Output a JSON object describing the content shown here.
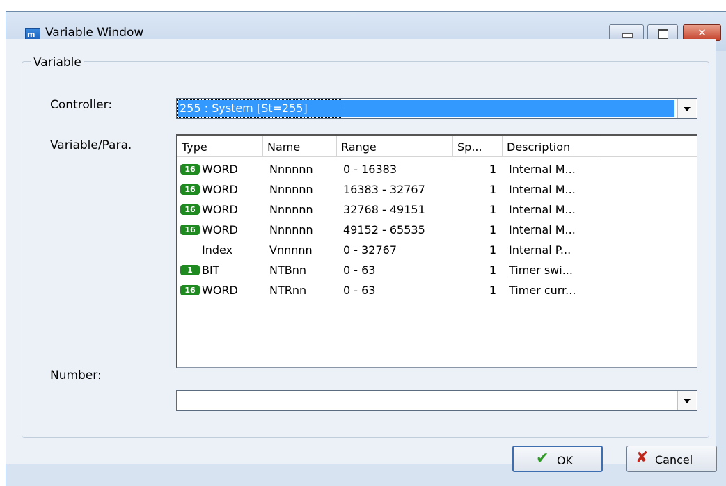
{
  "window": {
    "title": "Variable Window",
    "close_glyph": "✕"
  },
  "group": {
    "title": "Variable"
  },
  "controller": {
    "label": "Controller:",
    "value": "255 : System [St=255]"
  },
  "variable_para": {
    "label": "Variable/Para."
  },
  "number": {
    "label": "Number:",
    "value": ""
  },
  "table": {
    "columns": [
      "Type",
      "Name",
      "Range",
      "Sp...",
      "Description"
    ],
    "rows": [
      {
        "badge": "16",
        "type": "WORD",
        "name": "Nnnnnn",
        "range": "0 - 16383",
        "sp": "1",
        "description": "Internal M..."
      },
      {
        "badge": "16",
        "type": "WORD",
        "name": "Nnnnnn",
        "range": "16383 - 32767",
        "sp": "1",
        "description": "Internal M..."
      },
      {
        "badge": "16",
        "type": "WORD",
        "name": "Nnnnnn",
        "range": "32768 - 49151",
        "sp": "1",
        "description": "Internal M..."
      },
      {
        "badge": "16",
        "type": "WORD",
        "name": "Nnnnnn",
        "range": "49152 - 65535",
        "sp": "1",
        "description": "Internal M..."
      },
      {
        "badge": "",
        "type": "Index",
        "name": "Vnnnnn",
        "range": "0 - 32767",
        "sp": "1",
        "description": "Internal P..."
      },
      {
        "badge": "1",
        "type": "BIT",
        "name": "NTBnn",
        "range": "0 - 63",
        "sp": "1",
        "description": "Timer swi..."
      },
      {
        "badge": "16",
        "type": "WORD",
        "name": "NTRnn",
        "range": "0 - 63",
        "sp": "1",
        "description": "Timer curr..."
      }
    ]
  },
  "buttons": {
    "ok": {
      "label": "OK",
      "icon": "✔"
    },
    "cancel": {
      "label": "Cancel",
      "icon": "✘"
    }
  },
  "colors": {
    "selection": "#3399ff",
    "badge": "#1f8a1f",
    "ok_icon": "#2f9a24",
    "cancel_icon": "#c0261b"
  }
}
